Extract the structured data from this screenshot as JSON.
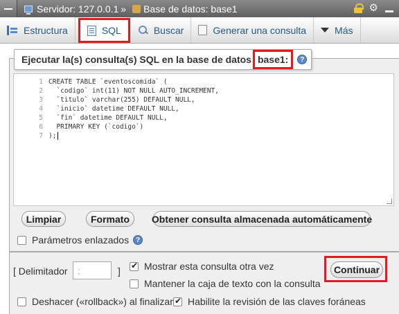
{
  "breadcrumb": {
    "server": "Servidor: 127.0.0.1",
    "separator": "»",
    "database": "Base de datos: base1"
  },
  "tabs": [
    {
      "label": "Estructura",
      "icon": "structure-icon"
    },
    {
      "label": "SQL",
      "icon": "sql-icon",
      "active": true
    },
    {
      "label": "Buscar",
      "icon": "search-icon"
    },
    {
      "label": "Generar una consulta",
      "icon": "query-icon"
    },
    {
      "label": "Más",
      "icon": "chevron-down-icon"
    }
  ],
  "sql_panel": {
    "legend_prefix": "Ejecutar la(s) consulta(s) SQL en la base de datos",
    "db_name": "base1:",
    "help": "?",
    "lines": [
      {
        "n": "1",
        "text": "CREATE TABLE `eventoscomida` ("
      },
      {
        "n": "2",
        "text": "  `codigo` int(11) NOT NULL AUTO_INCREMENT,"
      },
      {
        "n": "3",
        "text": "  `titulo` varchar(255) DEFAULT NULL,"
      },
      {
        "n": "4",
        "text": "  `inicio` datetime DEFAULT NULL,"
      },
      {
        "n": "5",
        "text": "  `fin` datetime DEFAULT NULL,"
      },
      {
        "n": "6",
        "text": "  PRIMARY KEY (`codigo`)"
      },
      {
        "n": "7",
        "text": ");"
      }
    ],
    "buttons": {
      "clear": "Limpiar",
      "format": "Formato",
      "bookmark": "Obtener consulta almacenada automáticamente"
    },
    "bind_params": "Parámetros enlazados"
  },
  "options": {
    "delimiter_label_open": "[ Delimitador",
    "delimiter_value": ";",
    "delimiter_label_close": "]",
    "show_query": {
      "label": "Mostrar esta consulta otra vez",
      "checked": true
    },
    "keep_box": {
      "label": "Mantener la caja de texto con la consulta",
      "checked": false
    },
    "rollback": {
      "label": "Deshacer («rollback») al finalizar",
      "checked": false
    },
    "foreign_keys": {
      "label": "Habilite la revisión de las claves foráneas",
      "checked": true
    },
    "continue": "Continuar"
  },
  "colors": {
    "highlight": "#e8191e",
    "tab_text": "#235a81",
    "panel_bg": "#efefef"
  }
}
